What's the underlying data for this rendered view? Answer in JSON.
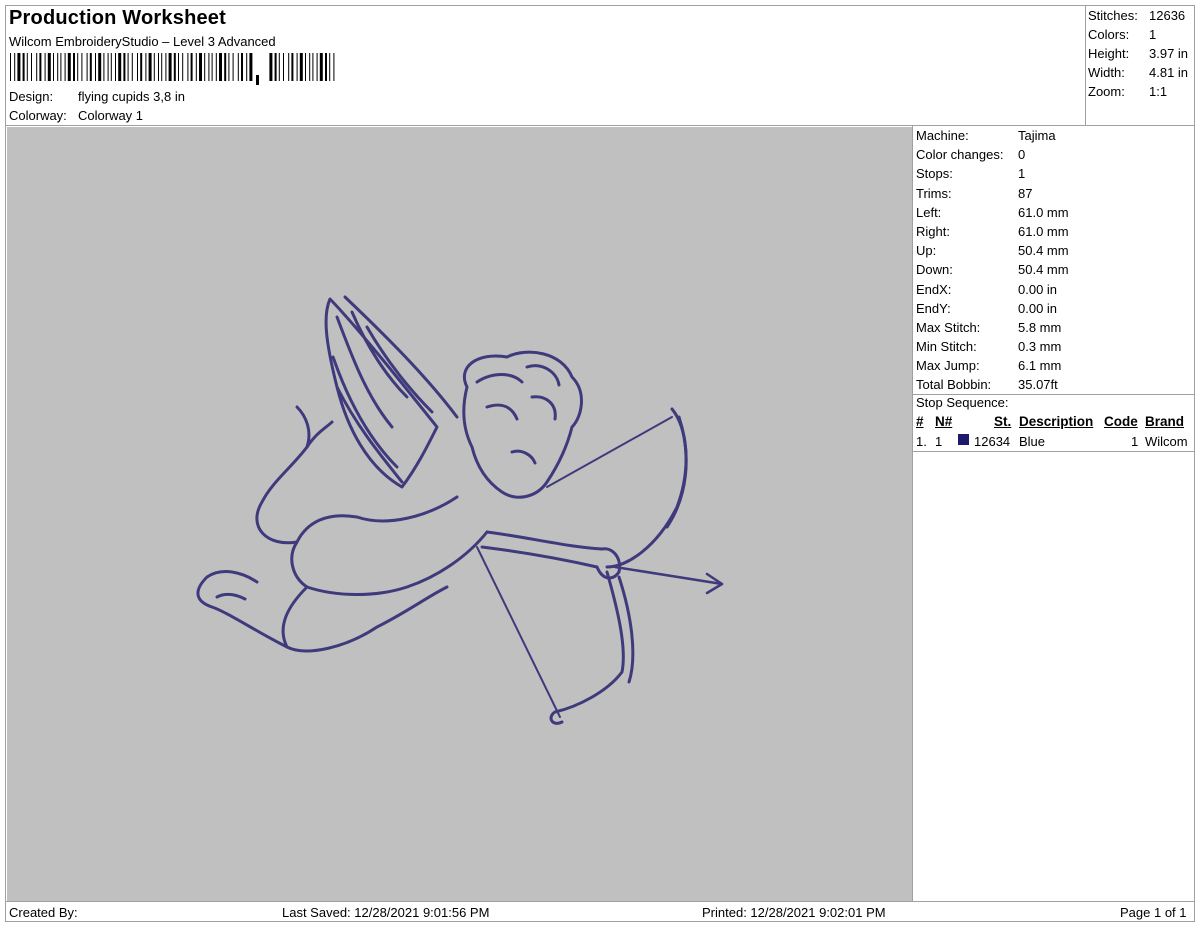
{
  "header": {
    "title": "Production Worksheet",
    "software": "Wilcom EmbroideryStudio – Level 3 Advanced",
    "design_label": "Design:",
    "design_value": "flying cupids 3,8 in",
    "colorway_label": "Colorway:",
    "colorway_value": "Colorway 1"
  },
  "summary": [
    {
      "label": "Stitches:",
      "value": "12636"
    },
    {
      "label": "Colors:",
      "value": "1"
    },
    {
      "label": "Height:",
      "value": "3.97 in"
    },
    {
      "label": "Width:",
      "value": "4.81 in"
    },
    {
      "label": "Zoom:",
      "value": "1:1"
    }
  ],
  "stats": [
    {
      "label": "Machine:",
      "value": "Tajima"
    },
    {
      "label": "Color changes:",
      "value": "0"
    },
    {
      "label": "Stops:",
      "value": "1"
    },
    {
      "label": "Trims:",
      "value": "87"
    },
    {
      "label": "Left:",
      "value": "61.0 mm"
    },
    {
      "label": "Right:",
      "value": "61.0 mm"
    },
    {
      "label": "Up:",
      "value": "50.4 mm"
    },
    {
      "label": "Down:",
      "value": "50.4 mm"
    },
    {
      "label": "EndX:",
      "value": "0.00 in"
    },
    {
      "label": "EndY:",
      "value": "0.00 in"
    },
    {
      "label": "Max Stitch:",
      "value": "5.8 mm"
    },
    {
      "label": "Min Stitch:",
      "value": "0.3 mm"
    },
    {
      "label": "Max Jump:",
      "value": "6.1 mm"
    },
    {
      "label": "Total Bobbin:",
      "value": "35.07ft"
    }
  ],
  "stop_sequence": {
    "title": "Stop Sequence:",
    "headers": {
      "num": "#",
      "needle": "N#",
      "stitches": "St.",
      "description": "Description",
      "code": "Code",
      "brand": "Brand"
    },
    "rows": [
      {
        "num": "1.",
        "needle": "1",
        "stitches": "12634",
        "description": "Blue",
        "code": "1",
        "brand": "Wilcom",
        "color": "#1e1a6e"
      }
    ]
  },
  "canvas": {
    "background": "#c0c0c0",
    "thread_color": "#3f3a7c"
  },
  "footer": {
    "created_by": "Created By:",
    "last_saved": "Last Saved: 12/28/2021 9:01:56 PM",
    "printed": "Printed: 12/28/2021 9:02:01 PM",
    "page": "Page 1 of 1"
  }
}
